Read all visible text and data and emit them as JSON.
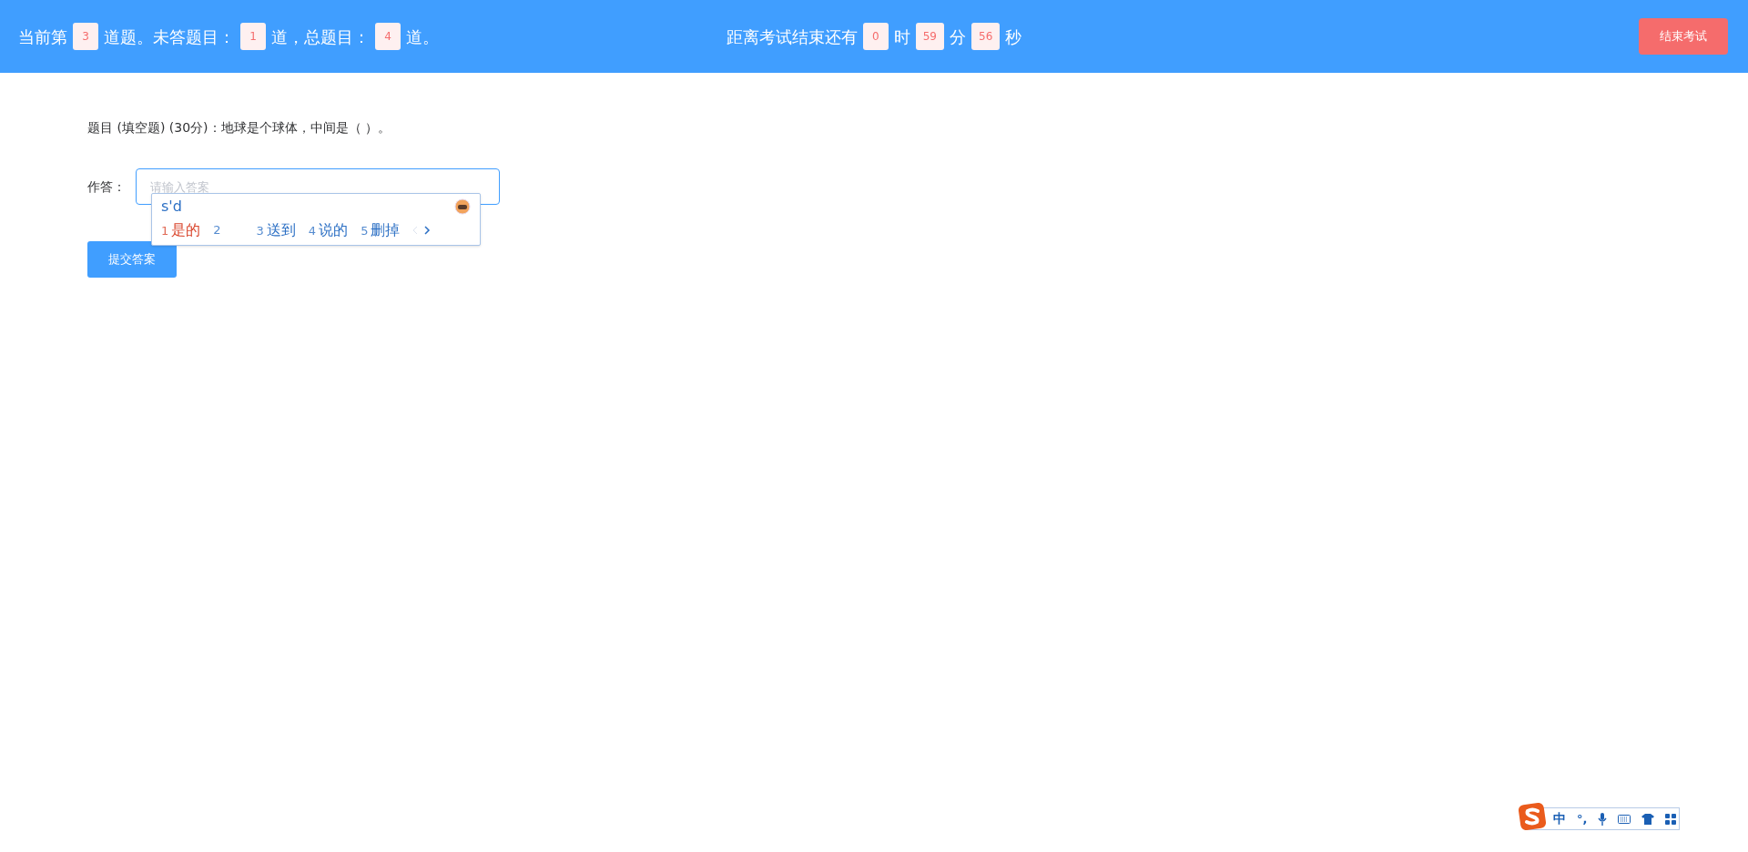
{
  "header": {
    "progress": [
      {
        "kind": "text",
        "text": "当前第"
      },
      {
        "kind": "badge",
        "text": "3"
      },
      {
        "kind": "text",
        "text": "道题。未答题目："
      },
      {
        "kind": "badge",
        "text": "1"
      },
      {
        "kind": "text",
        "text": "道，总题目："
      },
      {
        "kind": "badge",
        "text": "4"
      },
      {
        "kind": "text",
        "text": "道。"
      }
    ],
    "timer": [
      {
        "kind": "text",
        "text": "距离考试结束还有"
      },
      {
        "kind": "badge",
        "text": "0"
      },
      {
        "kind": "text",
        "text": "时"
      },
      {
        "kind": "badge",
        "text": "59"
      },
      {
        "kind": "text",
        "text": "分"
      },
      {
        "kind": "badge",
        "text": "56"
      },
      {
        "kind": "text",
        "text": "秒"
      }
    ],
    "end_button": "结束考试"
  },
  "question": "题目 (填空题) (30分)：地球是个球体，中间是（ ）。",
  "answer": {
    "label": "作答：",
    "placeholder": "请输入答案"
  },
  "ime_popup": {
    "composition": "s'd",
    "candidates": [
      {
        "index": "1",
        "text": "是的",
        "selected": true
      },
      {
        "index": "2",
        "selected": false
      },
      {
        "index": "3",
        "text": "送到",
        "selected": false
      },
      {
        "index": "4",
        "text": "说的",
        "selected": false
      },
      {
        "index": "5",
        "text": "删掉",
        "selected": false
      }
    ]
  },
  "submit_button": "提交答案",
  "ime_toolbar": {
    "language": "中",
    "punctuation": "°,"
  }
}
